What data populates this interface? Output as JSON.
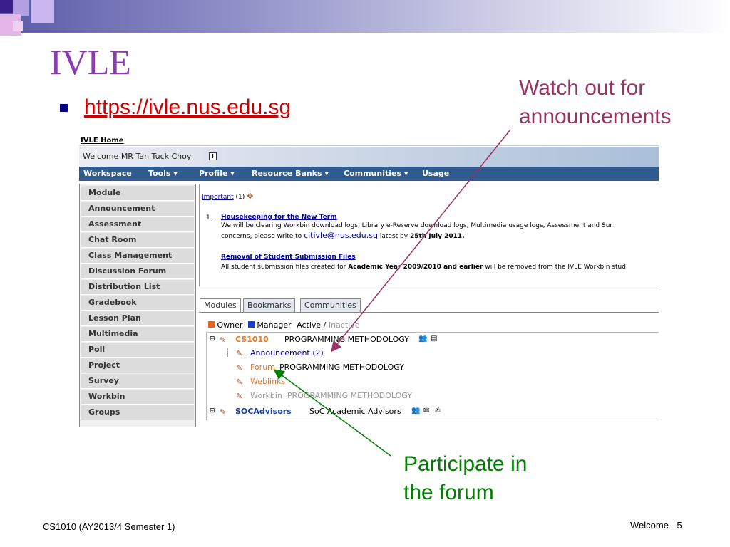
{
  "slide": {
    "title": "IVLE",
    "url": "https://ivle.nus.edu.sg",
    "note_announcements": [
      "Watch out for",
      "announcements"
    ],
    "note_forum": [
      "Participate in",
      "the forum"
    ],
    "footer_left": "CS1010 (AY2013/4 Semester 1)",
    "footer_right": "Welcome - 5"
  },
  "ivle": {
    "home_link": "IVLE Home",
    "welcome": "Welcome MR Tan Tuck Choy",
    "nav": [
      "Workspace",
      "Tools",
      "Profile",
      "Resource Banks",
      "Communities",
      "Usage"
    ],
    "sidebar": [
      "Module",
      "Announcement",
      "Assessment",
      "Chat Room",
      "Class Management",
      "Discussion Forum",
      "Distribution List",
      "Gradebook",
      "Lesson Plan",
      "Multimedia",
      "Poll",
      "Project",
      "Survey",
      "Workbin",
      "Groups"
    ],
    "important_label": "Important",
    "important_count": "(1)",
    "ann_number": "1.",
    "ann1_title": "Housekeeping for the New Term",
    "ann1_line1": "We will be clearing Workbin download logs, Library e-Reserve download logs, Multimedia usage logs, Assessment and Sur",
    "ann1_line2a": "concerns, please write to",
    "ann1_email": "citivle@nus.edu.sg",
    "ann1_line2b": "latest by",
    "ann1_date": "25th July 2011.",
    "ann2_title": "Removal of Student Submission Files",
    "ann2_line_a": "All student submission files created for",
    "ann2_line_bold": "Academic Year 2009/2010 and earlier",
    "ann2_line_b": "will be removed from the IVLE Workbin stud",
    "tabs": [
      "Modules",
      "Bookmarks",
      "Communities"
    ],
    "legend_owner": "Owner",
    "legend_manager": "Manager",
    "legend_active": "Active",
    "legend_slash": "/",
    "legend_inactive": "Inactive",
    "module_code": "CS1010",
    "module_name": "PROGRAMMING METHODOLOGY",
    "item_announcement": "Announcement (2)",
    "item_forum": "Forum",
    "item_forum_desc": "PROGRAMMING METHODOLOGY",
    "item_weblinks": "Weblinks",
    "item_workbin": "Workbin",
    "item_workbin_desc": "PROGRAMMING METHODOLOGY",
    "soc_code": "SOCAdvisors",
    "soc_name": "SoC Academic Advisors"
  },
  "colors": {
    "title": "#8a3bb0",
    "url": "#cc0000",
    "note_announcements": "#993366",
    "note_forum": "#008000",
    "nav_bar": "#2f5b8e",
    "module_code": "#e87722",
    "link_blue": "#000099"
  }
}
